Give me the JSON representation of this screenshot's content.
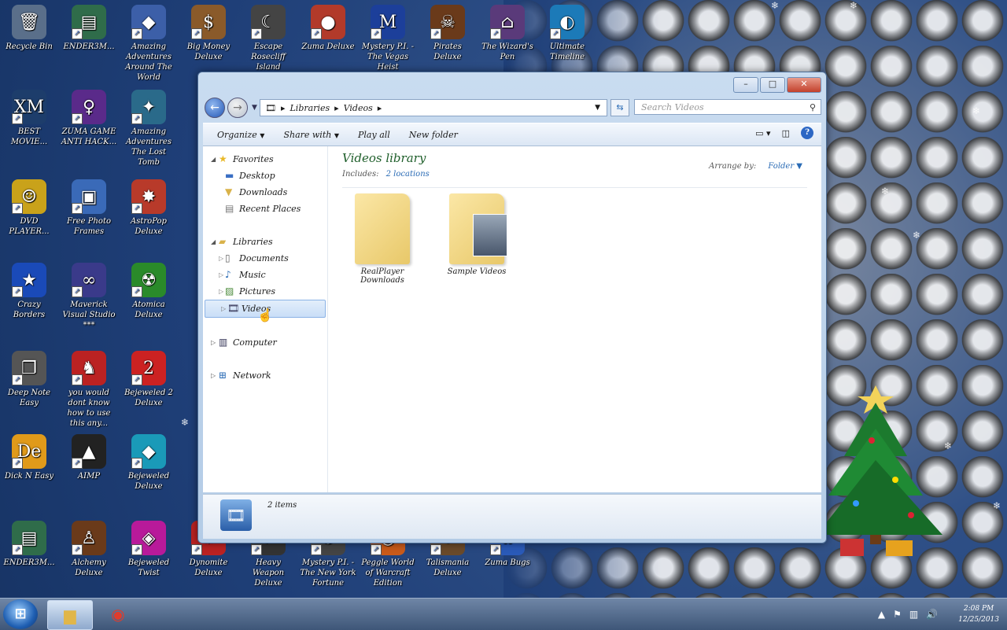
{
  "desktop": {
    "icons": [
      {
        "label": "Recycle Bin",
        "glyph": "🗑"
      },
      {
        "label": "ENDER3M...",
        "glyph": "▤"
      },
      {
        "label": "Amazing Adventures Around The World",
        "glyph": "◆"
      },
      {
        "label": "Big Money Deluxe",
        "glyph": "$"
      },
      {
        "label": "Escape Rosecliff Island",
        "glyph": "☾"
      },
      {
        "label": "Zuma Deluxe",
        "glyph": "●"
      },
      {
        "label": "Mystery P.I. - The Vegas Heist",
        "glyph": "M"
      },
      {
        "label": "Pirates Deluxe",
        "glyph": "☠"
      },
      {
        "label": "The Wizard's Pen",
        "glyph": "⌂"
      },
      {
        "label": "Ultimate Timeline",
        "glyph": "◐"
      },
      {
        "label": "BEST MOVIE...",
        "glyph": "XM"
      },
      {
        "label": "ZUMA GAME ANTI HACK...",
        "glyph": "♀"
      },
      {
        "label": "Amazing Adventures The Lost Tomb",
        "glyph": "✦"
      },
      {
        "label": "DVD PLAYER...",
        "glyph": "☺"
      },
      {
        "label": "Free Photo Frames",
        "glyph": "▣"
      },
      {
        "label": "AstroPop Deluxe",
        "glyph": "✸"
      },
      {
        "label": "Crazy Borders",
        "glyph": "★"
      },
      {
        "label": "Maverick Visual Studio ***",
        "glyph": "∞"
      },
      {
        "label": "Atomica Deluxe",
        "glyph": "☢"
      },
      {
        "label": "Deep Note Easy",
        "glyph": "❐"
      },
      {
        "label": "you would dont know how to use this any...",
        "glyph": "♞"
      },
      {
        "label": "Bejeweled 2 Deluxe",
        "glyph": "2"
      },
      {
        "label": "Dick N Easy",
        "glyph": "De"
      },
      {
        "label": "AIMP",
        "glyph": "▲"
      },
      {
        "label": "Bejeweled Deluxe",
        "glyph": "◆"
      },
      {
        "label": "ENDER3M...",
        "glyph": "▤"
      },
      {
        "label": "Alchemy Deluxe",
        "glyph": "♙"
      },
      {
        "label": "Bejeweled Twist",
        "glyph": "◈"
      },
      {
        "label": "Dynomite Deluxe",
        "glyph": "✹"
      },
      {
        "label": "Heavy Weapon Deluxe",
        "glyph": "✈"
      },
      {
        "label": "Mystery P.I. - The New York Fortune",
        "glyph": "✪"
      },
      {
        "label": "Peggle World of Warcraft Edition",
        "glyph": "◉"
      },
      {
        "label": "Talismania Deluxe",
        "glyph": "⚱"
      },
      {
        "label": "Zuma Bugs",
        "glyph": "✿"
      }
    ]
  },
  "window": {
    "address": [
      "Libraries",
      "Videos"
    ],
    "search_placeholder": "Search Videos",
    "toolbar": {
      "organize": "Organize",
      "share_with": "Share with",
      "play_all": "Play all",
      "new_folder": "New folder"
    },
    "nav": {
      "favorites": {
        "label": "Favorites",
        "items": [
          "Desktop",
          "Downloads",
          "Recent Places"
        ]
      },
      "libraries": {
        "label": "Libraries",
        "items": [
          "Documents",
          "Music",
          "Pictures",
          "Videos"
        ]
      },
      "computer": "Computer",
      "network": "Network"
    },
    "library": {
      "title": "Videos library",
      "includes_label": "Includes:",
      "includes_value": "2 locations",
      "arrange_label": "Arrange by:",
      "arrange_value": "Folder"
    },
    "folders": [
      {
        "name": "RealPlayer Downloads"
      },
      {
        "name": "Sample Videos"
      }
    ],
    "details": {
      "count": "2 items"
    }
  },
  "taskbar": {
    "clock_time": "2:08 PM",
    "clock_date": "12/25/2013"
  }
}
